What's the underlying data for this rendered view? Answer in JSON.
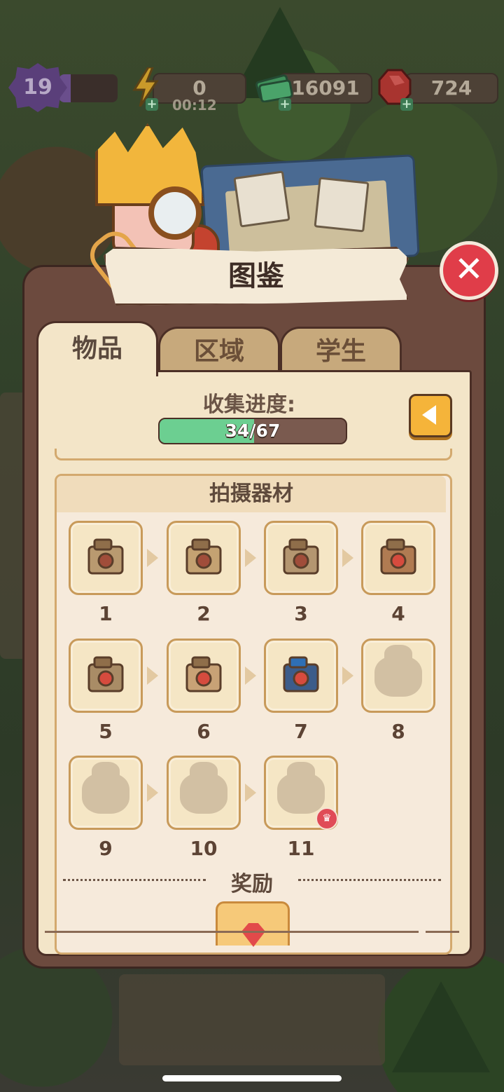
{
  "hud": {
    "level": "19",
    "level_progress": 0.2,
    "energy": "0",
    "energy_timer": "00:12",
    "cash": "16091",
    "gems": "724"
  },
  "panel": {
    "title": "图鉴",
    "close_icon": "close-x-icon",
    "tabs": [
      {
        "label": "物品",
        "active": true
      },
      {
        "label": "区域",
        "active": false
      },
      {
        "label": "学生",
        "active": false
      }
    ],
    "progress": {
      "label": "收集进度:",
      "current": 34,
      "total": 67,
      "text": "34/67"
    },
    "category": {
      "title": "拍摄器材",
      "items": [
        {
          "number": "1",
          "unlocked": true,
          "icon": "camera-stage-1-icon"
        },
        {
          "number": "2",
          "unlocked": true,
          "icon": "camera-stage-2-icon"
        },
        {
          "number": "3",
          "unlocked": true,
          "icon": "camera-stage-3-icon"
        },
        {
          "number": "4",
          "unlocked": true,
          "icon": "camera-stage-4-icon"
        },
        {
          "number": "5",
          "unlocked": true,
          "icon": "camera-stage-5-icon"
        },
        {
          "number": "6",
          "unlocked": true,
          "icon": "camera-stage-6-icon"
        },
        {
          "number": "7",
          "unlocked": true,
          "icon": "camera-stage-7-icon"
        },
        {
          "number": "8",
          "unlocked": false,
          "icon": "locked-silhouette-icon"
        },
        {
          "number": "9",
          "unlocked": false,
          "icon": "locked-silhouette-icon"
        },
        {
          "number": "10",
          "unlocked": false,
          "icon": "locked-silhouette-icon"
        },
        {
          "number": "11",
          "unlocked": false,
          "icon": "locked-silhouette-icon",
          "badge": "crown-icon"
        }
      ],
      "reward_label": "奖励"
    }
  },
  "colors": {
    "panel_brown": "#6c4a3e",
    "inner_cream": "#f3e5c8",
    "progress_green": "#6ccf91",
    "close_red": "#e03d49",
    "back_orange": "#f5b43a"
  }
}
